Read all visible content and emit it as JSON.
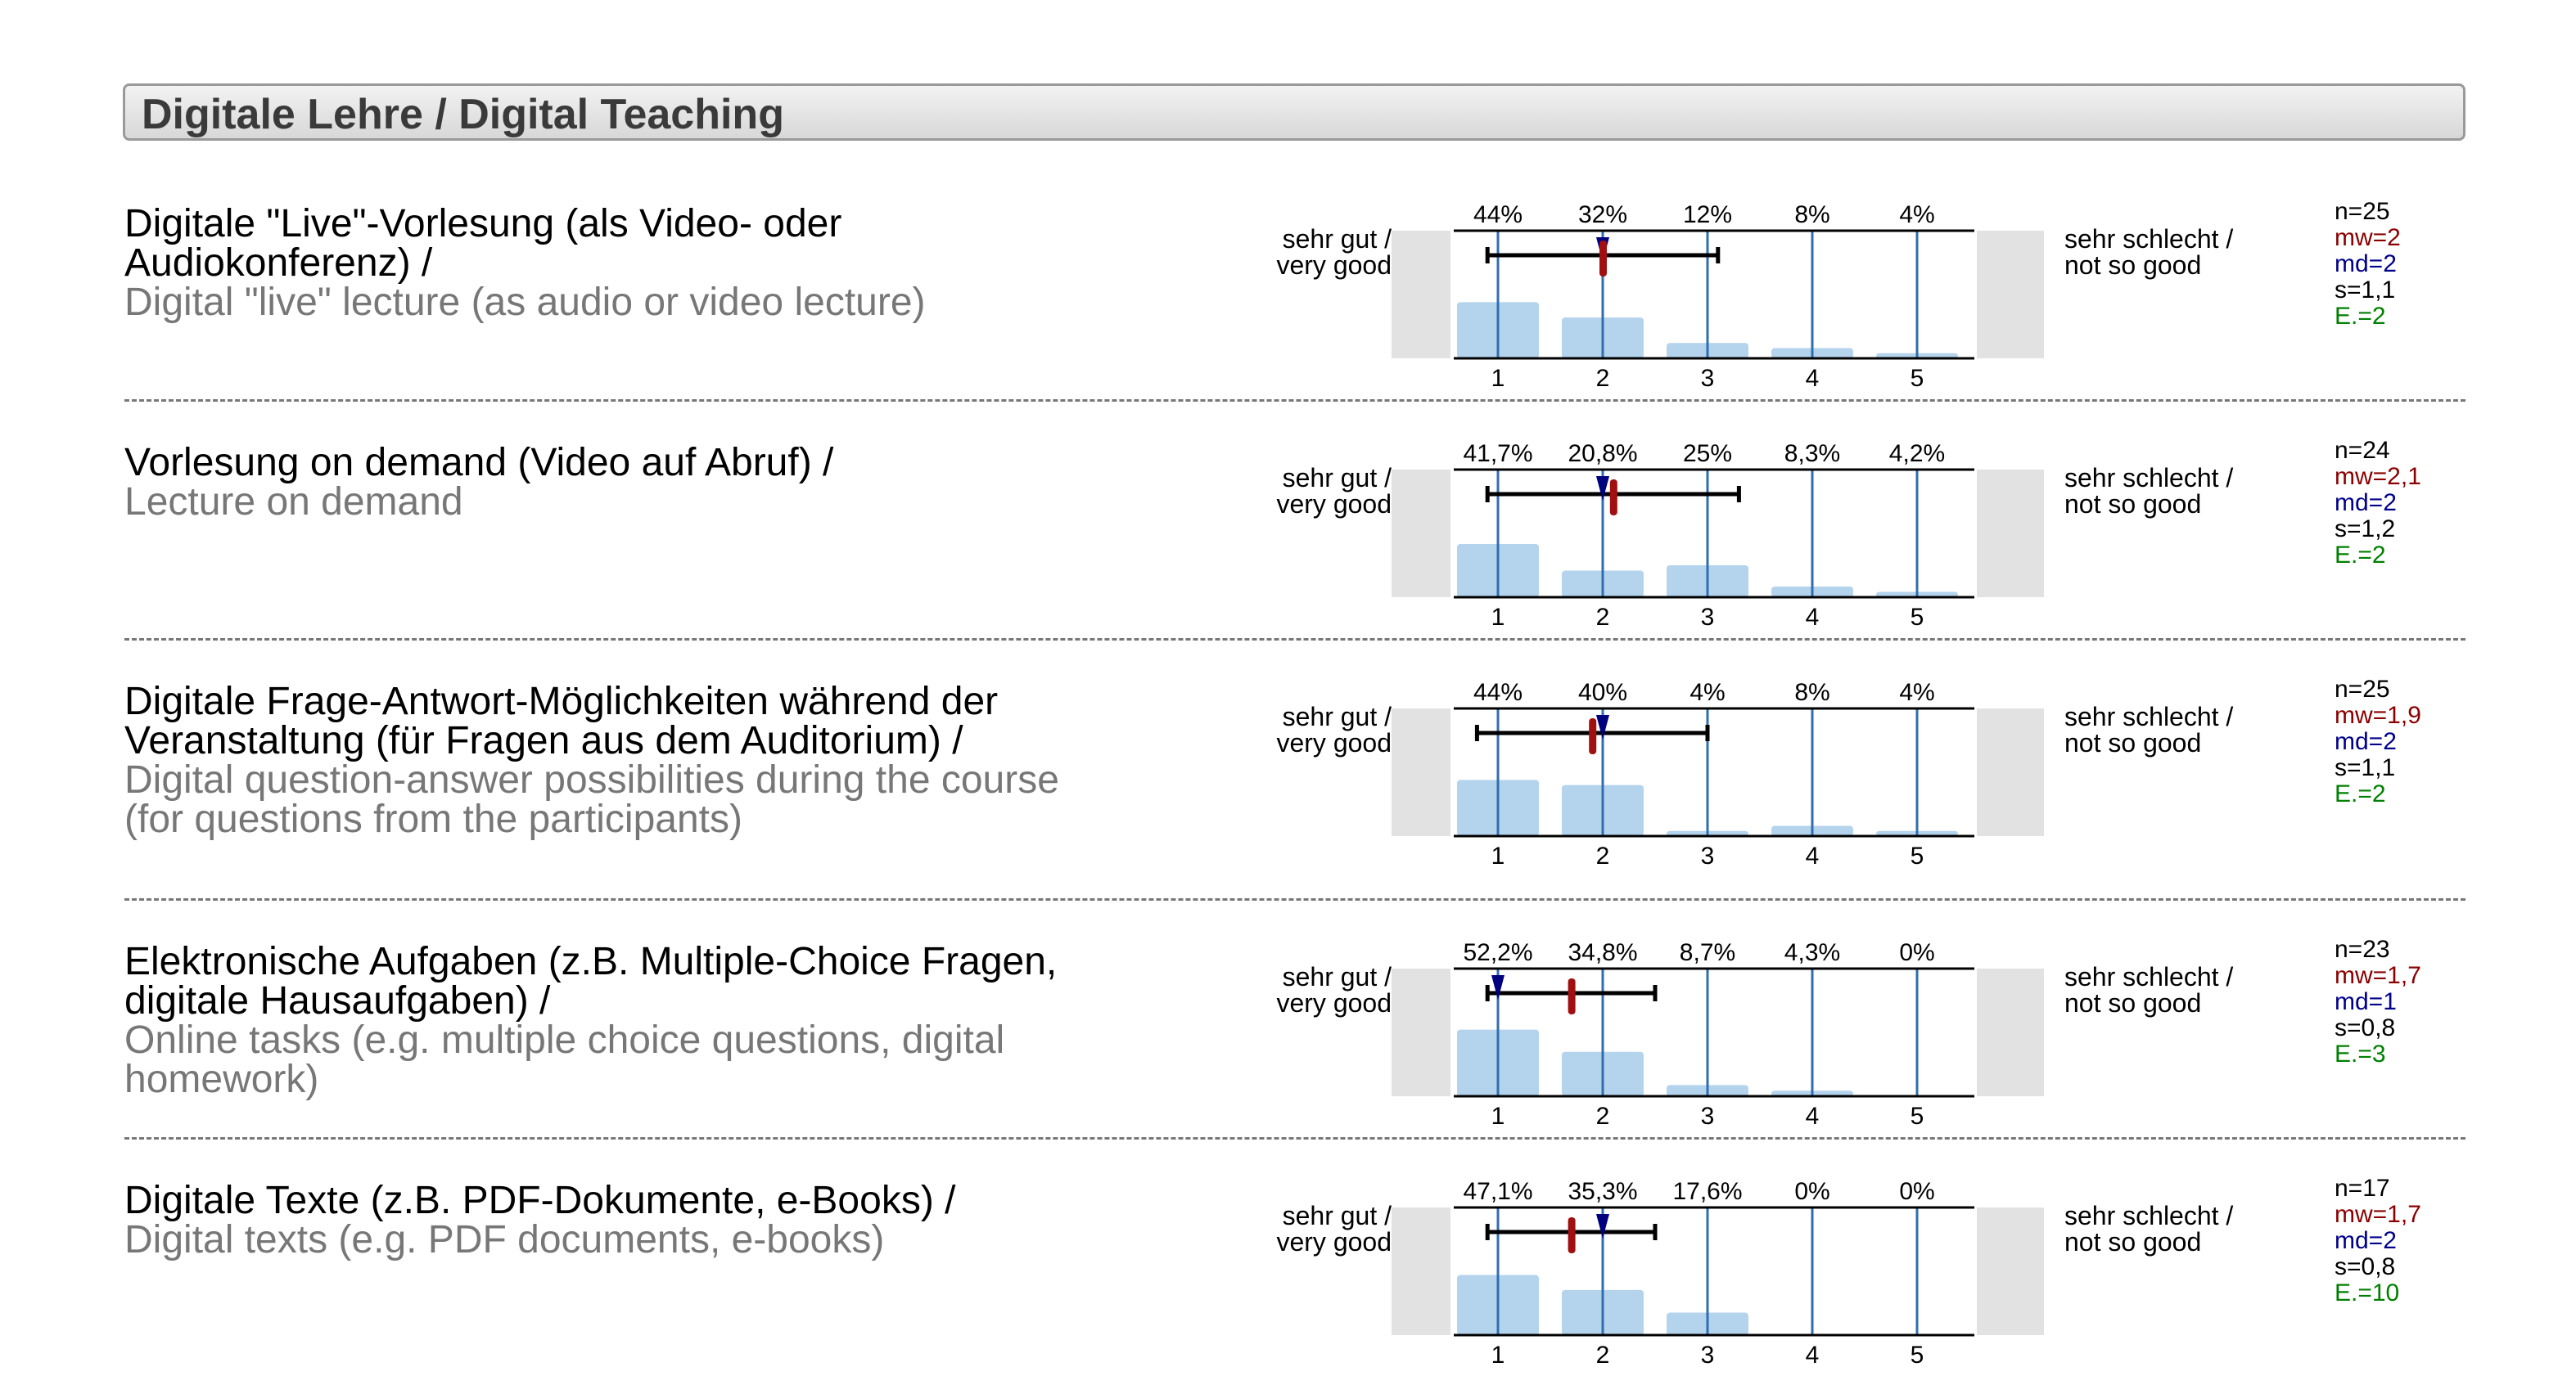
{
  "section": {
    "title": "Digitale Lehre / Digital Teaching"
  },
  "scale": {
    "left_label_de": "sehr gut /",
    "left_label_en": "very good",
    "right_label_de": "sehr schlecht /",
    "right_label_en": "not so good"
  },
  "colors": {
    "bar": "#b4d3ec",
    "gridline": "#2f6fb0",
    "mean": "#a01010",
    "median": "#00007f",
    "header_bg": "#e3e3e3",
    "side_panel": "#e2e2e2"
  },
  "questions": [
    {
      "de": "Digitale \"Live\"-Vorlesung (als Video- oder Audiokonferenz) /",
      "en": "Digital \"live\" lecture (as audio or video lecture)",
      "stats": {
        "n": "n=25",
        "mw": "mw=2",
        "md": "md=2",
        "s": "s=1,1",
        "e": "E.=2"
      }
    },
    {
      "de": "Vorlesung on demand (Video auf Abruf) /",
      "en": "Lecture on demand",
      "stats": {
        "n": "n=24",
        "mw": "mw=2,1",
        "md": "md=2",
        "s": "s=1,2",
        "e": "E.=2"
      }
    },
    {
      "de": "Digitale Frage-Antwort-Möglichkeiten während der Veranstaltung (für Fragen aus dem Auditorium) /",
      "en": "Digital question-answer possibilities during the course (for questions from the participants)",
      "stats": {
        "n": "n=25",
        "mw": "mw=1,9",
        "md": "md=2",
        "s": "s=1,1",
        "e": "E.=2"
      }
    },
    {
      "de": "Elektronische Aufgaben (z.B. Multiple-Choice Fragen, digitale Hausaufgaben) /",
      "en": "Online tasks (e.g. multiple choice questions, digital homework)",
      "stats": {
        "n": "n=23",
        "mw": "mw=1,7",
        "md": "md=1",
        "s": "s=0,8",
        "e": "E.=3"
      }
    },
    {
      "de": "Digitale Texte (z.B. PDF-Dokumente, e-Books) /",
      "en": "Digital texts (e.g. PDF documents, e-books)",
      "stats": {
        "n": "n=17",
        "mw": "mw=1,7",
        "md": "md=2",
        "s": "s=0,8",
        "e": "E.=10"
      }
    }
  ],
  "chart_data": [
    {
      "type": "bar",
      "categories": [
        "1",
        "2",
        "3",
        "4",
        "5"
      ],
      "values": [
        44,
        32,
        12,
        8,
        4
      ],
      "labels": [
        "44%",
        "32%",
        "12%",
        "8%",
        "4%"
      ],
      "mean": 2.0,
      "median": 2,
      "sd": 1.1,
      "n": 25,
      "ylim": [
        0,
        100
      ]
    },
    {
      "type": "bar",
      "categories": [
        "1",
        "2",
        "3",
        "4",
        "5"
      ],
      "values": [
        41.7,
        20.8,
        25,
        8.3,
        4.2
      ],
      "labels": [
        "41,7%",
        "20,8%",
        "25%",
        "8,3%",
        "4,2%"
      ],
      "mean": 2.1,
      "median": 2,
      "sd": 1.2,
      "n": 24,
      "ylim": [
        0,
        100
      ]
    },
    {
      "type": "bar",
      "categories": [
        "1",
        "2",
        "3",
        "4",
        "5"
      ],
      "values": [
        44,
        40,
        4,
        8,
        4
      ],
      "labels": [
        "44%",
        "40%",
        "4%",
        "8%",
        "4%"
      ],
      "mean": 1.9,
      "median": 2,
      "sd": 1.1,
      "n": 25,
      "ylim": [
        0,
        100
      ]
    },
    {
      "type": "bar",
      "categories": [
        "1",
        "2",
        "3",
        "4",
        "5"
      ],
      "values": [
        52.2,
        34.8,
        8.7,
        4.3,
        0
      ],
      "labels": [
        "52,2%",
        "34,8%",
        "8,7%",
        "4,3%",
        "0%"
      ],
      "mean": 1.7,
      "median": 1,
      "sd": 0.8,
      "n": 23,
      "ylim": [
        0,
        100
      ]
    },
    {
      "type": "bar",
      "categories": [
        "1",
        "2",
        "3",
        "4",
        "5"
      ],
      "values": [
        47.1,
        35.3,
        17.6,
        0,
        0
      ],
      "labels": [
        "47,1%",
        "35,3%",
        "17,6%",
        "0%",
        "0%"
      ],
      "mean": 1.7,
      "median": 2,
      "sd": 0.8,
      "n": 17,
      "ylim": [
        0,
        100
      ]
    }
  ]
}
